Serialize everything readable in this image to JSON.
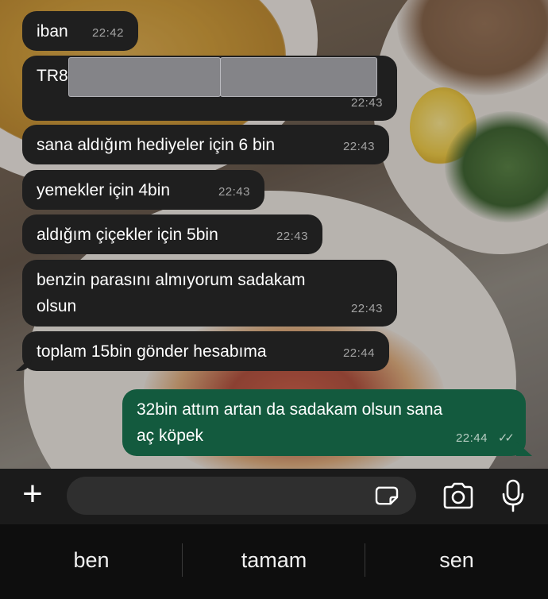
{
  "messages": [
    {
      "text": "iban",
      "time": "22:42",
      "dir": "in"
    },
    {
      "text": "TR8",
      "time": "22:43",
      "dir": "in"
    },
    {
      "text": "sana aldığım hediyeler için 6 bin",
      "time": "22:43",
      "dir": "in"
    },
    {
      "text": "yemekler için 4bin",
      "time": "22:43",
      "dir": "in"
    },
    {
      "text": "aldığım çiçekler için 5bin",
      "time": "22:43",
      "dir": "in"
    },
    {
      "line1": "benzin parasını almıyorum sadakam",
      "line2": "olsun",
      "time": "22:43",
      "dir": "in"
    },
    {
      "text": "toplam 15bin gönder hesabıma",
      "time": "22:44",
      "dir": "in"
    },
    {
      "line1": "32bin attım artan da sadakam olsun sana",
      "line2": "aç köpek",
      "time": "22:44",
      "dir": "out",
      "status": "read"
    }
  ],
  "input": {
    "placeholder": ""
  },
  "icons": {
    "add": "plus-icon",
    "sticker": "sticker-icon",
    "camera": "camera-icon",
    "mic": "microphone-icon"
  },
  "suggestions": [
    "ben",
    "tamam",
    "sen"
  ],
  "colors": {
    "incoming_bubble": "#1f1f1f",
    "outgoing_bubble": "#135a3e"
  }
}
